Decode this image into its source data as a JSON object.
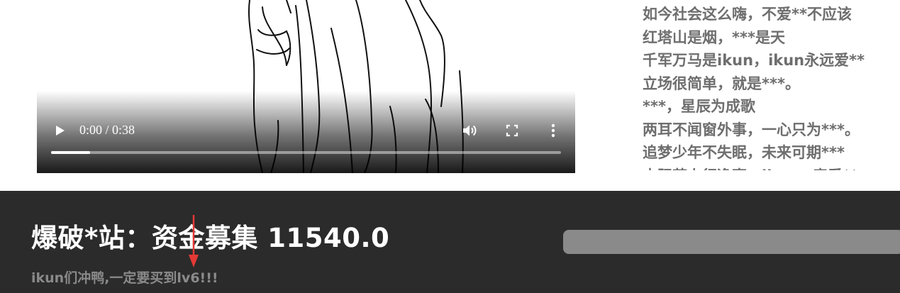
{
  "video": {
    "current_time": "0:00",
    "duration": "0:38",
    "time_separator": " / ",
    "progress_fraction": 0.0
  },
  "lyrics": {
    "lines": [
      "如今社会这么嗨，不爱**不应该",
      "红塔山是烟，***是天",
      "千军万马是ikun，ikun永远爱**",
      "立场很简单，就是***。",
      "***，星辰为成歌",
      "两耳不闻窗外事，一心只为***。",
      "追梦少年不失眠，未来可期***",
      "去阳若上行逸事，ikun，表爱**"
    ]
  },
  "funding": {
    "title": "爆破*站：资金募集 11540.0",
    "slogan": "ikun们冲鸭,一定要买到lv6!!!"
  },
  "colors": {
    "bar_bg": "#2b2b2b",
    "lyric_text": "#6e6e6e",
    "arrow": "#e53935"
  },
  "icons": [
    "play-icon",
    "volume-icon",
    "fullscreen-icon",
    "more-vert-icon"
  ]
}
